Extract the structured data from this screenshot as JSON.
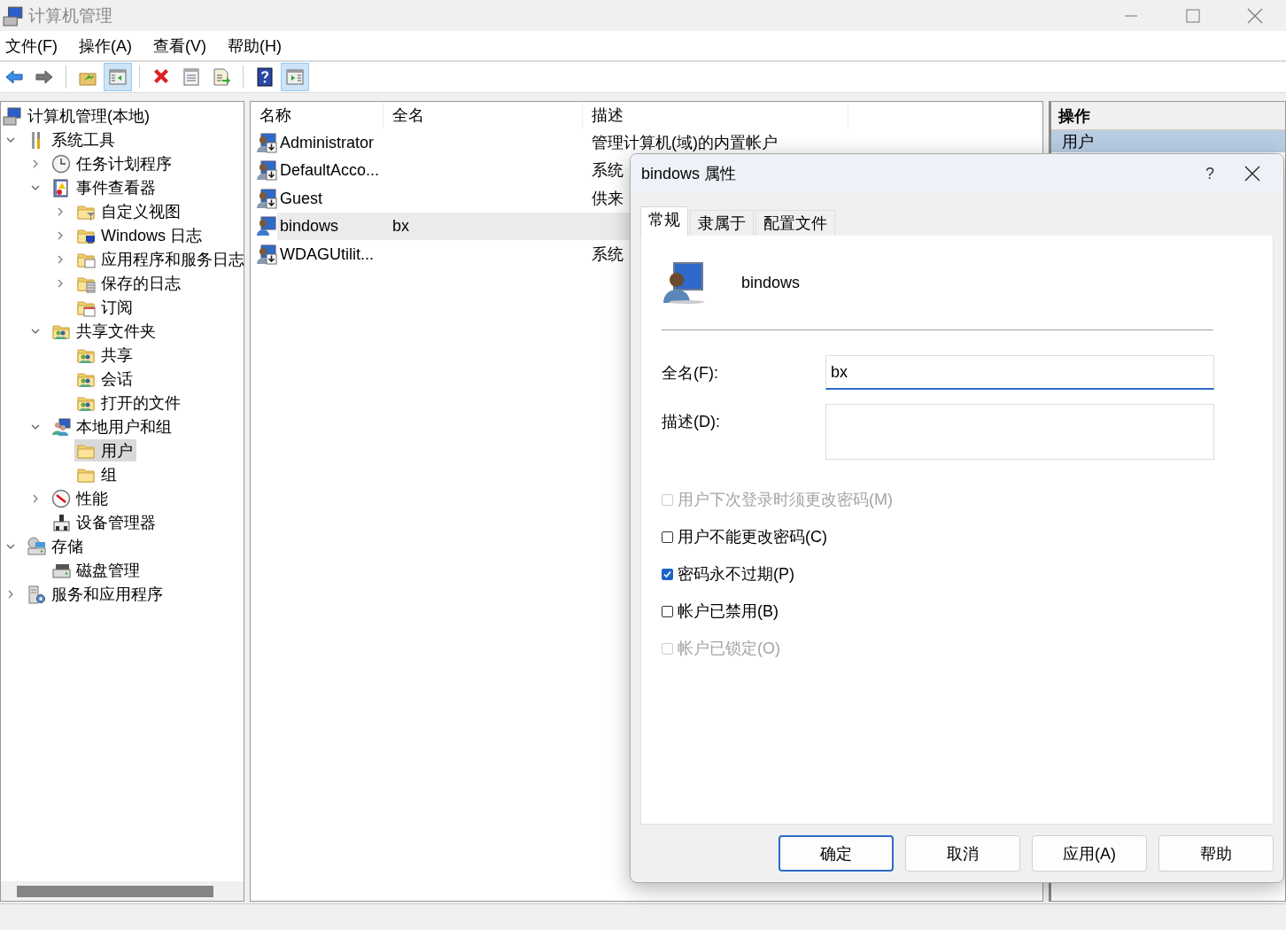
{
  "window": {
    "title": "计算机管理"
  },
  "menu": [
    "文件(F)",
    "操作(A)",
    "查看(V)",
    "帮助(H)"
  ],
  "toolbar": [
    {
      "kind": "back",
      "pressed": false
    },
    {
      "kind": "forward",
      "pressed": false
    },
    {
      "kind": "sep"
    },
    {
      "kind": "up",
      "pressed": false
    },
    {
      "kind": "tree",
      "pressed": true
    },
    {
      "kind": "sep"
    },
    {
      "kind": "delete",
      "pressed": false
    },
    {
      "kind": "properties",
      "pressed": false
    },
    {
      "kind": "export",
      "pressed": false
    },
    {
      "kind": "sep"
    },
    {
      "kind": "help",
      "pressed": false
    },
    {
      "kind": "pane",
      "pressed": true
    }
  ],
  "tree": {
    "items": [
      {
        "label": "计算机管理(本地)",
        "kind": "computer",
        "selected": false,
        "children": [
          {
            "label": "系统工具",
            "kind": "tools",
            "expandable": true,
            "expanded": true,
            "selected": false,
            "children": [
              {
                "label": "任务计划程序",
                "kind": "clock",
                "expandable": true,
                "expanded": false,
                "selected": false
              },
              {
                "label": "事件查看器",
                "kind": "event",
                "expandable": true,
                "expanded": true,
                "selected": false,
                "children": [
                  {
                    "label": "自定义视图",
                    "kind": "folder-filter",
                    "expandable": true,
                    "expanded": false,
                    "selected": false
                  },
                  {
                    "label": "Windows 日志",
                    "kind": "folder-monitor",
                    "expandable": true,
                    "expanded": false,
                    "selected": false
                  },
                  {
                    "label": "应用程序和服务日志",
                    "kind": "folder-window",
                    "expandable": true,
                    "expanded": false,
                    "selected": false
                  },
                  {
                    "label": "保存的日志",
                    "kind": "folder-log",
                    "expandable": true,
                    "expanded": false,
                    "selected": false
                  },
                  {
                    "label": "订阅",
                    "kind": "folder-calendar",
                    "expandable": false,
                    "expanded": false,
                    "selected": false
                  }
                ]
              },
              {
                "label": "共享文件夹",
                "kind": "share",
                "expandable": true,
                "expanded": true,
                "selected": false,
                "children": [
                  {
                    "label": "共享",
                    "kind": "share",
                    "expandable": false,
                    "expanded": false,
                    "selected": false
                  },
                  {
                    "label": "会话",
                    "kind": "share",
                    "expandable": false,
                    "expanded": false,
                    "selected": false
                  },
                  {
                    "label": "打开的文件",
                    "kind": "share",
                    "expandable": false,
                    "expanded": false,
                    "selected": false
                  }
                ]
              },
              {
                "label": "本地用户和组",
                "kind": "users",
                "expandable": true,
                "expanded": true,
                "selected": false,
                "children": [
                  {
                    "label": "用户",
                    "kind": "folder",
                    "expandable": false,
                    "expanded": false,
                    "selected": true
                  },
                  {
                    "label": "组",
                    "kind": "folder",
                    "expandable": false,
                    "expanded": false,
                    "selected": false
                  }
                ]
              },
              {
                "label": "性能",
                "kind": "perf",
                "expandable": true,
                "expanded": false,
                "selected": false
              },
              {
                "label": "设备管理器",
                "kind": "device",
                "expandable": false,
                "expanded": false,
                "selected": false
              }
            ]
          },
          {
            "label": "存储",
            "kind": "storage",
            "expandable": true,
            "expanded": true,
            "selected": false,
            "children": [
              {
                "label": "磁盘管理",
                "kind": "disk",
                "expandable": false,
                "expanded": false,
                "selected": false
              }
            ]
          },
          {
            "label": "服务和应用程序",
            "kind": "services",
            "expandable": true,
            "expanded": false,
            "selected": false
          }
        ]
      }
    ]
  },
  "list": {
    "columns": [
      "名称",
      "全名",
      "描述"
    ],
    "rows": [
      {
        "name": "Administrator",
        "description": "管理计算机(域)的内置帐户",
        "disabled": true,
        "selected": false
      },
      {
        "name": "DefaultAcco...",
        "description": "系统",
        "disabled": true,
        "selected": false
      },
      {
        "name": "Guest",
        "description": "供来",
        "disabled": true,
        "selected": false
      },
      {
        "name": "bindows",
        "full_name": "bx",
        "disabled": false,
        "selected": true
      },
      {
        "name": "WDAGUtilit...",
        "description": "系统",
        "disabled": true,
        "selected": false
      }
    ]
  },
  "actions": {
    "title": "操作",
    "section": "用户"
  },
  "dialog": {
    "title": "bindows 属性",
    "help": "?",
    "tabs": [
      {
        "label": "常规",
        "selected": true
      },
      {
        "label": "隶属于",
        "selected": false
      },
      {
        "label": "配置文件",
        "selected": false
      }
    ],
    "user_name": "bindows",
    "fields": [
      {
        "label": "全名(F):",
        "value": "bx",
        "kind": "line"
      },
      {
        "label": "描述(D):",
        "kind": "area"
      }
    ],
    "checkboxes": [
      {
        "label": "用户下次登录时须更改密码(M)",
        "checked": false,
        "disabled": true
      },
      {
        "label": "用户不能更改密码(C)",
        "checked": false,
        "disabled": false
      },
      {
        "label": "密码永不过期(P)",
        "checked": true,
        "disabled": false
      },
      {
        "label": "帐户已禁用(B)",
        "checked": false,
        "disabled": false
      },
      {
        "label": "帐户已锁定(O)",
        "checked": false,
        "disabled": true
      }
    ],
    "buttons": [
      {
        "label": "确定",
        "default": true
      },
      {
        "label": "取消",
        "default": false
      },
      {
        "label": "应用(A)",
        "default": false
      },
      {
        "label": "帮助",
        "default": false
      }
    ]
  }
}
